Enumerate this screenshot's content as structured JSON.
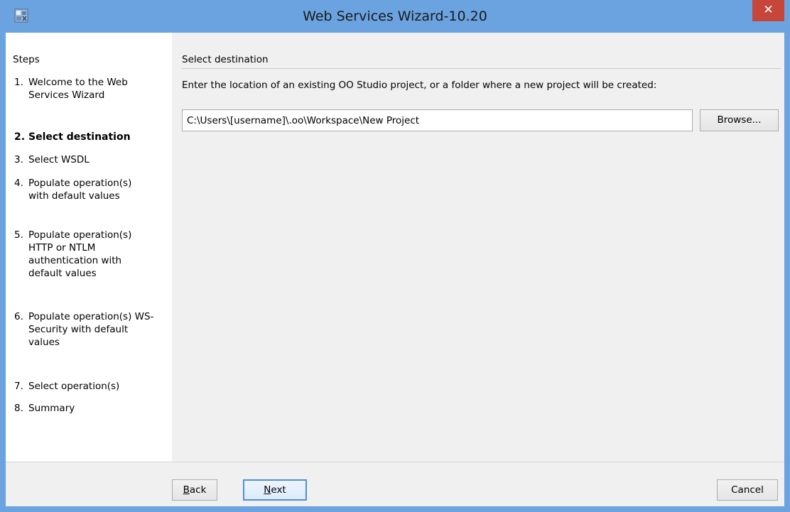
{
  "window": {
    "title": "Web Services Wizard-10.20",
    "close_label": "✕"
  },
  "steps": {
    "header": "Steps",
    "items": [
      {
        "num": "1.",
        "label": "Welcome to the Web Services Wizard",
        "current": false
      },
      {
        "num": "2.",
        "label": "Select destination",
        "current": true
      },
      {
        "num": "3.",
        "label": "Select WSDL",
        "current": false
      },
      {
        "num": "4.",
        "label": "Populate operation(s) with default values",
        "current": false
      },
      {
        "num": "5.",
        "label": "Populate operation(s) HTTP or NTLM authentication with default values",
        "current": false
      },
      {
        "num": "6.",
        "label": "Populate operation(s) WS-Security with default values",
        "current": false
      },
      {
        "num": "7.",
        "label": "Select operation(s)",
        "current": false
      },
      {
        "num": "8.",
        "label": "Summary",
        "current": false
      }
    ]
  },
  "content": {
    "section_title": "Select destination",
    "prompt": "Enter the location of an existing OO Studio project, or a folder where a new project will be created:",
    "path_value": "C:\\Users\\[username]\\.oo\\Workspace\\New Project",
    "browse_label": "Browse..."
  },
  "footer": {
    "back_mnemonic": "B",
    "back_rest": "ack",
    "next_mnemonic": "N",
    "next_rest": "ext",
    "cancel_label": "Cancel"
  },
  "colors": {
    "titlebar": "#6aa3e0",
    "close": "#c7463a",
    "panel": "#f0f0f0",
    "default_button_border": "#4f8fd8"
  }
}
